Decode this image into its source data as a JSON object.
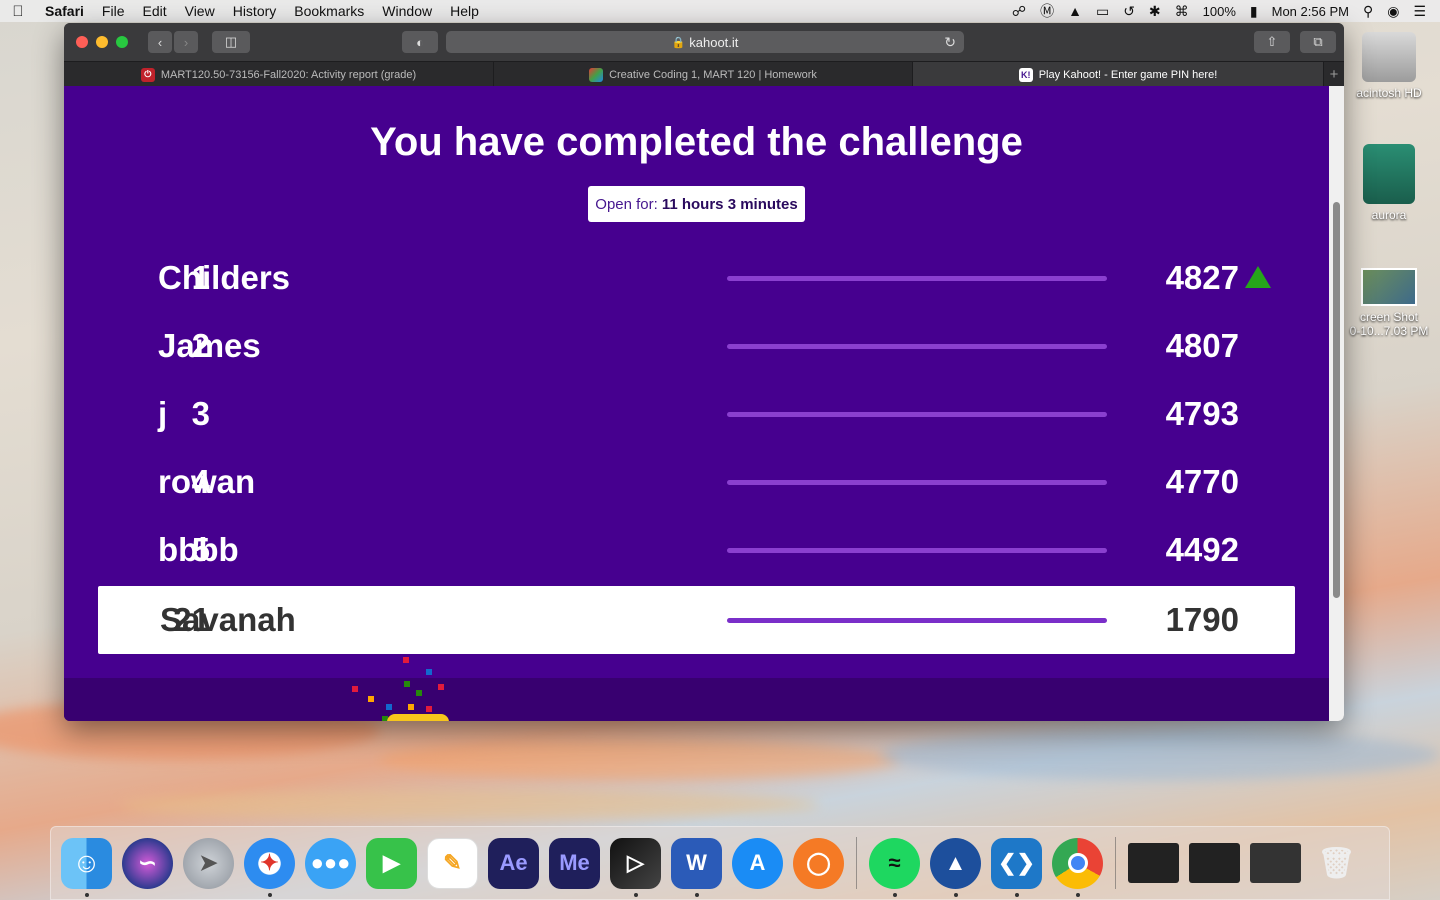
{
  "menubar": {
    "app": "Safari",
    "items": [
      "File",
      "Edit",
      "View",
      "History",
      "Bookmarks",
      "Window",
      "Help"
    ],
    "battery": "100%",
    "clock": "Mon 2:56 PM"
  },
  "desktop": {
    "icons": [
      "acintosh HD",
      "aurora",
      "creen Shot\n0-10...7.03 PM"
    ]
  },
  "browser": {
    "url": "kahoot.it",
    "tabs": [
      {
        "title": "MART120.50-73156-Fall2020: Activity report (grade)",
        "favicon": "power-icon"
      },
      {
        "title": "Creative Coding 1, MART 120 | Homework",
        "favicon": "triangle-logo-icon"
      },
      {
        "title": "Play Kahoot! - Enter game PIN here!",
        "favicon": "kahoot-icon"
      }
    ]
  },
  "challenge": {
    "title": "You have completed the challenge",
    "open_label": "Open for:",
    "open_value": "11 hours 3 minutes",
    "leaderboard": [
      {
        "rank": "1",
        "name": "Childers",
        "score": "4827",
        "trend": "up"
      },
      {
        "rank": "2",
        "name": "James",
        "score": "4807"
      },
      {
        "rank": "3",
        "name": "j",
        "score": "4793"
      },
      {
        "rank": "4",
        "name": "rowan",
        "score": "4770"
      },
      {
        "rank": "5",
        "name": "bbbb",
        "score": "4492"
      },
      {
        "rank": "21",
        "name": "Savanah",
        "score": "1790",
        "current_user": true
      }
    ]
  },
  "dock": {
    "apps": [
      "Finder",
      "Siri",
      "Launchpad",
      "Safari",
      "Messages",
      "FaceTime",
      "Pages",
      "Ae",
      "Me",
      "Final Cut Pro",
      "Word",
      "App Store",
      "Origin",
      "Spotify",
      "Mountain",
      "Visual Studio Code",
      "Chrome",
      "Trash"
    ]
  },
  "colors": {
    "page_bg": "#46008f",
    "accent_bar": "#8a3fcf",
    "trend_up": "#26a51b"
  }
}
